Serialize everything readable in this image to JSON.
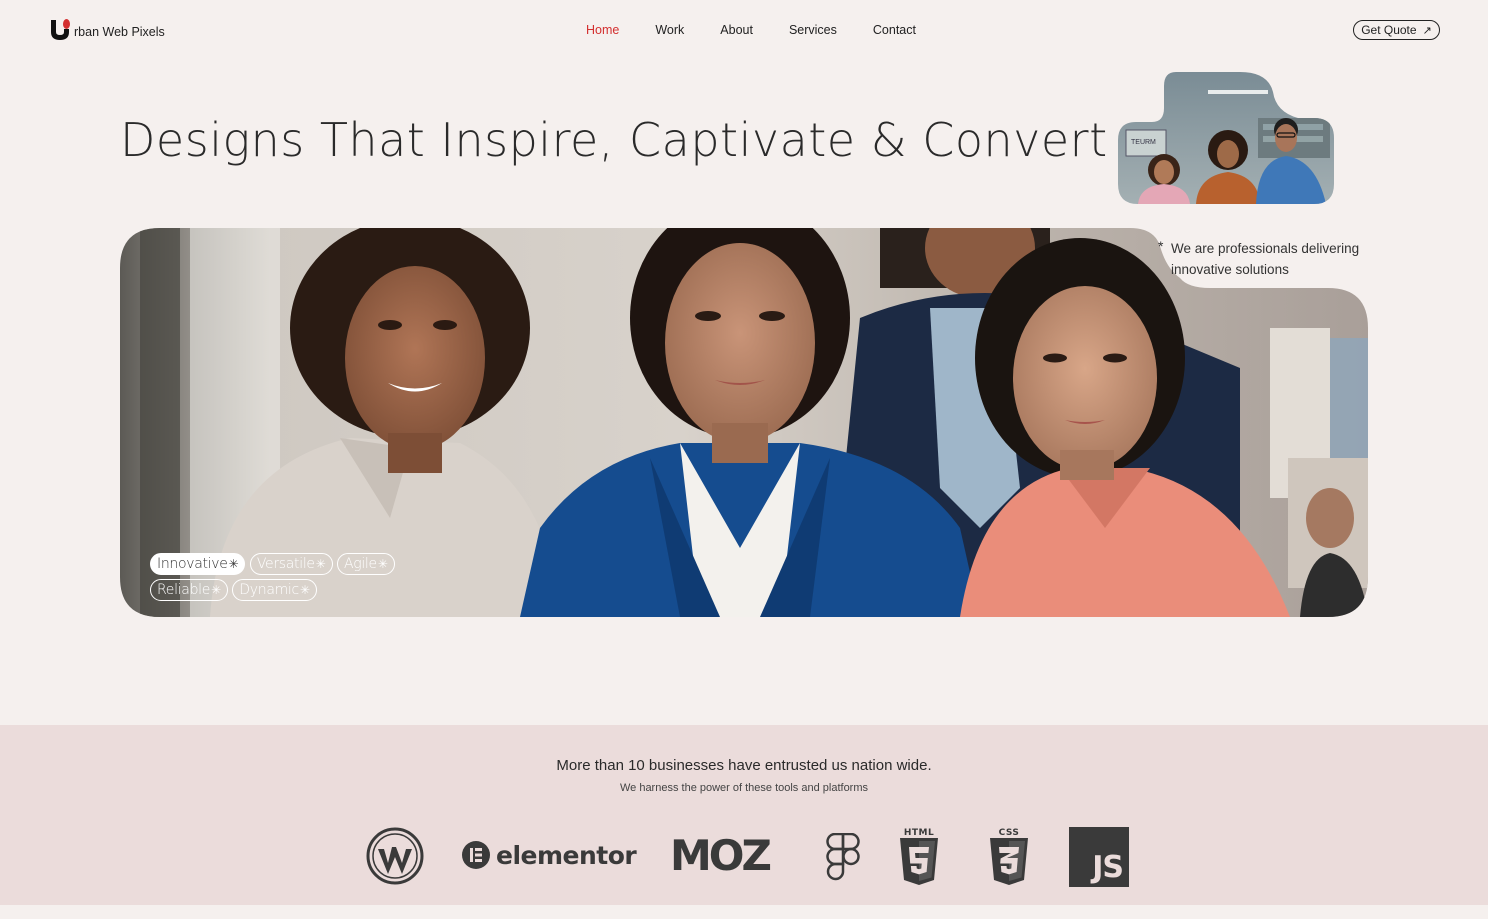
{
  "brand": {
    "name": "rban Web Pixels",
    "accent_color": "#d32f2f",
    "logo_icon": "u-letter-logo-icon"
  },
  "nav": {
    "items": [
      {
        "label": "Home",
        "active": true
      },
      {
        "label": "Work",
        "active": false
      },
      {
        "label": "About",
        "active": false
      },
      {
        "label": "Services",
        "active": false
      },
      {
        "label": "Contact",
        "active": false
      }
    ],
    "cta_label": "Get Quote",
    "cta_icon": "arrow-up-right-icon"
  },
  "hero": {
    "title": "Designs That Inspire, Captivate & Convert",
    "tagline_marker": "*",
    "tagline": "We are professionals delivering innovative solutions",
    "tags": [
      {
        "label": "Innovative",
        "active": true
      },
      {
        "label": "Versatile",
        "active": false
      },
      {
        "label": "Agile",
        "active": false
      },
      {
        "label": "Reliable",
        "active": false
      },
      {
        "label": "Dynamic",
        "active": false
      }
    ],
    "tag_star": "✳",
    "team_sign_text": "TEURM"
  },
  "partners": {
    "title": "More than 10 businesses have entrusted us nation wide.",
    "subtitle": "We harness the power of these tools and platforms",
    "logos": [
      {
        "name": "wordpress-icon"
      },
      {
        "name": "elementor-icon",
        "text": "elementor"
      },
      {
        "name": "moz-icon",
        "text": "MOZ"
      },
      {
        "name": "figma-icon"
      },
      {
        "name": "html5-icon",
        "text": "HTML"
      },
      {
        "name": "css3-icon",
        "text": "CSS"
      },
      {
        "name": "javascript-icon",
        "text": "JS"
      }
    ]
  }
}
